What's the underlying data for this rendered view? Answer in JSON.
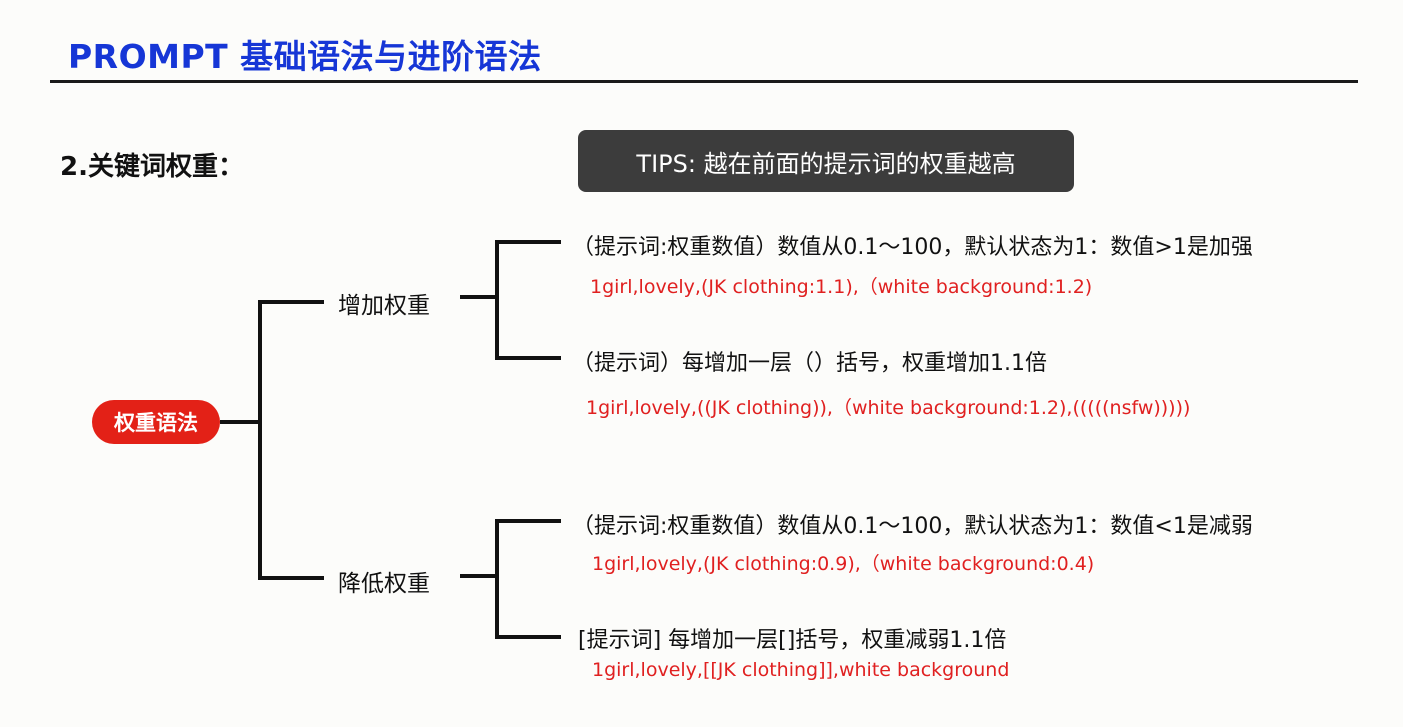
{
  "header": {
    "title": "PROMPT 基础语法与进阶语法"
  },
  "section": {
    "title": "2.关键词权重："
  },
  "tips": {
    "text": "TIPS: 越在前面的提示词的权重越高"
  },
  "root": {
    "label": "权重语法"
  },
  "branches": [
    {
      "label": "增加权重",
      "items": [
        {
          "rule": "（提示词:权重数值）数值从0.1～100，默认状态为1：数值>1是加强",
          "example": "1girl,lovely,(JK clothing:1.1),（white background:1.2)"
        },
        {
          "rule": "（提示词）每增加一层（）括号，权重增加1.1倍",
          "example": "1girl,lovely,((JK clothing)),（white background:1.2),(((((nsfw)))))"
        }
      ]
    },
    {
      "label": "降低权重",
      "items": [
        {
          "rule": "（提示词:权重数值）数值从0.1～100，默认状态为1：数值<1是减弱",
          "example": "1girl,lovely,(JK clothing:0.9),（white background:0.4)"
        },
        {
          "rule": "[提示词]   每增加一层[]括号，权重减弱1.1倍",
          "example": "1girl,lovely,[[JK clothing]],white background"
        }
      ]
    }
  ],
  "colors": {
    "title": "#1636d6",
    "root_pill": "#e32117",
    "example_text": "#e02020",
    "tips_bg": "#3c3c3c"
  }
}
